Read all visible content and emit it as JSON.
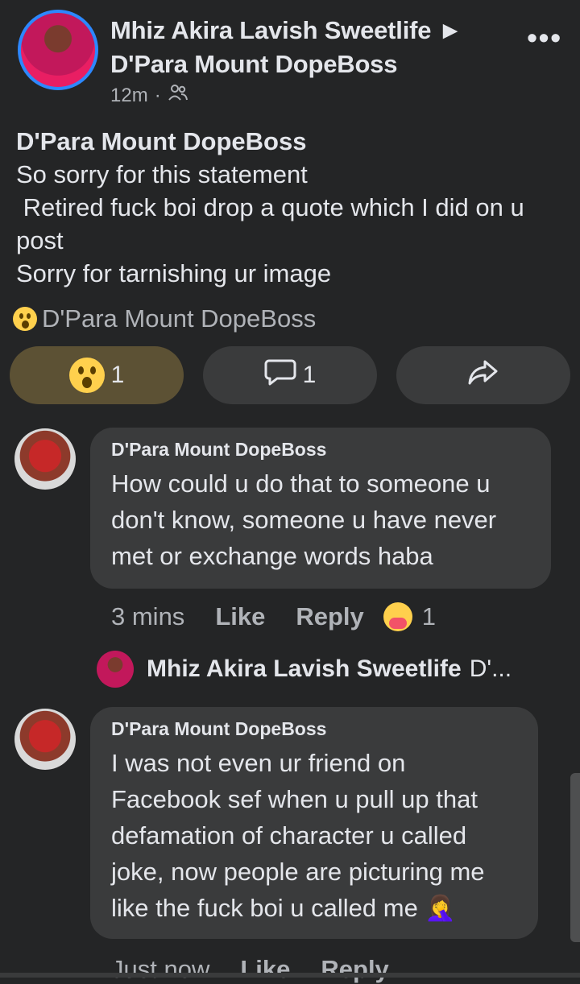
{
  "post": {
    "author_line1": "Mhiz Akira Lavish Sweetlife ►",
    "author_line2": "D'Para Mount DopeBoss",
    "time": "12m",
    "audience_icon": "friends-icon",
    "more_label": "•••",
    "title": "D'Para Mount DopeBoss",
    "lines": [
      "So sorry for this statement",
      " Retired fuck boi drop a quote which I did on u post",
      "Sorry for tarnishing ur image"
    ],
    "reaction_summary": "D'Para Mount DopeBoss"
  },
  "actions": {
    "like_count": "1",
    "comment_count": "1"
  },
  "comments": [
    {
      "name": "D'Para Mount DopeBoss",
      "text": "How could u do that to someone u don't know, someone u have never met or exchange words haba",
      "time": "3 mins",
      "like": "Like",
      "reply": "Reply",
      "reaction_count": "1"
    },
    {
      "name": "D'Para Mount DopeBoss",
      "text": "I was not even ur friend on Facebook sef when u pull up that defamation of character u called joke, now people are picturing me like the fuck boi u called me 🤦‍♀️",
      "time": "Just now",
      "like": "Like",
      "reply": "Reply"
    }
  ],
  "reply_preview": {
    "name": "Mhiz Akira Lavish Sweetlife",
    "snippet": "D'..."
  },
  "colors": {
    "background": "#242526",
    "bubble": "#3a3b3c",
    "accent": "#2d88ff",
    "liked_button": "#5c5134"
  }
}
